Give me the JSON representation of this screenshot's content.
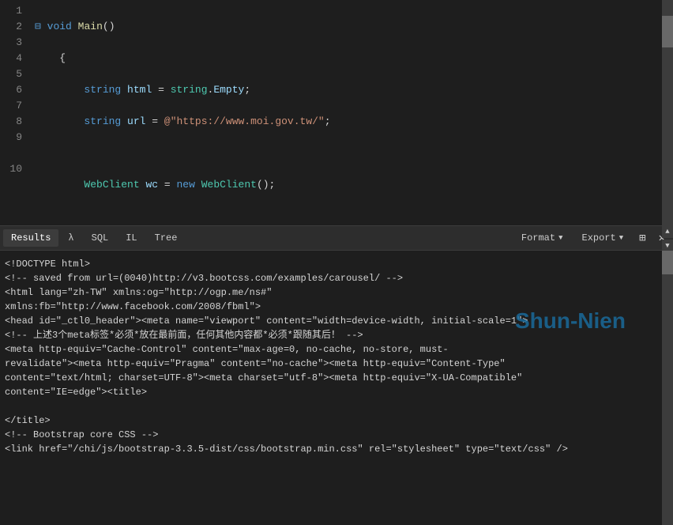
{
  "toolbar": {
    "tabs": [
      {
        "id": "results",
        "label": "Results",
        "active": true
      },
      {
        "id": "lambda",
        "label": "λ",
        "active": false
      },
      {
        "id": "sql",
        "label": "SQL",
        "active": false
      },
      {
        "id": "il",
        "label": "IL",
        "active": false
      },
      {
        "id": "tree",
        "label": "Tree",
        "active": false
      }
    ],
    "format_label": "Format",
    "export_label": "Export",
    "grid_icon": "⊞",
    "close_icon": "✕"
  },
  "watermark": {
    "text": "Shun-Nien"
  },
  "output": {
    "lines": [
      "<!DOCTYPE html>",
      "<!-- saved from url=(0040)http://v3.bootcss.com/examples/carousel/ -->",
      "<html lang=\"zh-TW\" xmlns:og=\"http://ogp.me/ns#\"",
      "xmlns:fb=\"http://www.facebook.com/2008/fbml\">",
      "<head id=\"_ctl0_header\"><meta name=\"viewport\" content=\"width=device-width, initial-scale=1\">",
      "<!-- 上述3个meta标签*必须*放在最前面，任何其他内容都*必须*跟随其后！ -->",
      "<meta http-equiv=\"Cache-Control\" content=\"max-age=0, no-cache, no-store, must-",
      "revalidate\"><meta http-equiv=\"Pragma\" content=\"no-cache\"><meta http-equiv=\"Content-Type\"",
      "content=\"text/html; charset=UTF-8\"><meta charset=\"utf-8\"><meta http-equiv=\"X-UA-Compatible\"",
      "content=\"IE=edge\"><title>",
      "",
      "</title>",
      "<!-- Bootstrap core CSS -->",
      "<link href=\"/chi/js/bootstrap-3.3.5-dist/css/bootstrap.min.css\" rel=\"stylesheet\" type=\"text/css\" />"
    ]
  }
}
